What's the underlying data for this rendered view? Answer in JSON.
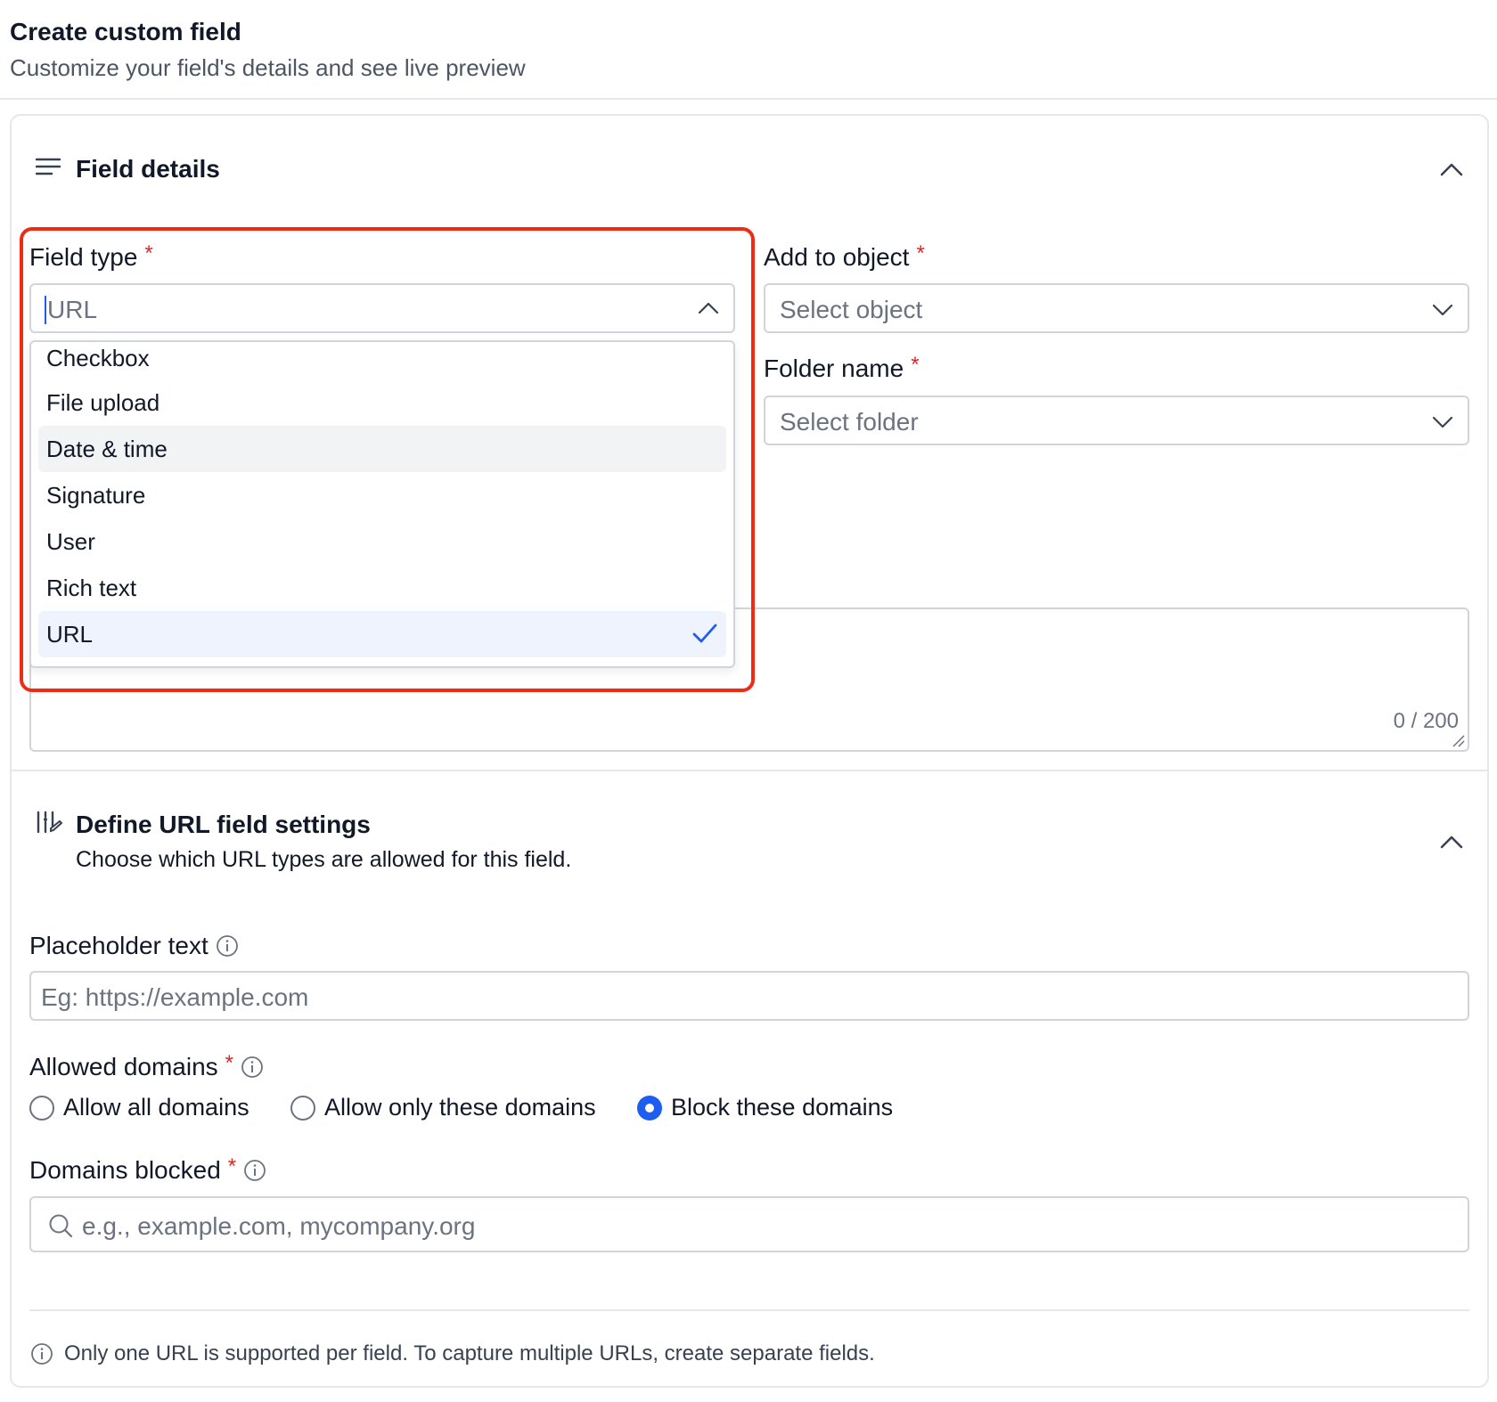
{
  "header": {
    "title": "Create custom field",
    "subtitle": "Customize your field's details and see live preview"
  },
  "field_details": {
    "title": "Field details",
    "icon": "lines-icon",
    "field_type": {
      "label": "Field type",
      "required_mark": "*",
      "value": "URL",
      "options": [
        "Checkbox",
        "File upload",
        "Date & time",
        "Signature",
        "User",
        "Rich text",
        "URL"
      ],
      "hovered": "Date & time",
      "selected": "URL"
    },
    "add_to_object": {
      "label": "Add to object",
      "required_mark": "*",
      "placeholder": "Select object"
    },
    "folder_name": {
      "label": "Folder name",
      "required_mark": "*",
      "placeholder": "Select folder"
    },
    "description_counter": "0 / 200"
  },
  "url_settings": {
    "title": "Define URL field settings",
    "description": "Choose which URL types are allowed for this field.",
    "placeholder_text": {
      "label": "Placeholder text",
      "placeholder": "Eg: https://example.com"
    },
    "allowed_domains": {
      "label": "Allowed domains",
      "required_mark": "*",
      "options": [
        "Allow all domains",
        "Allow only these domains",
        "Block these domains"
      ],
      "selected": "Block these domains"
    },
    "domains_blocked": {
      "label": "Domains blocked",
      "required_mark": "*",
      "placeholder": "e.g., example.com, mycompany.org"
    },
    "footer_note": "Only one URL is supported per field. To capture multiple URLs, create separate fields."
  },
  "colors": {
    "accent": "#1d5df0",
    "required": "#dc2626",
    "highlight": "#ef2b16"
  }
}
